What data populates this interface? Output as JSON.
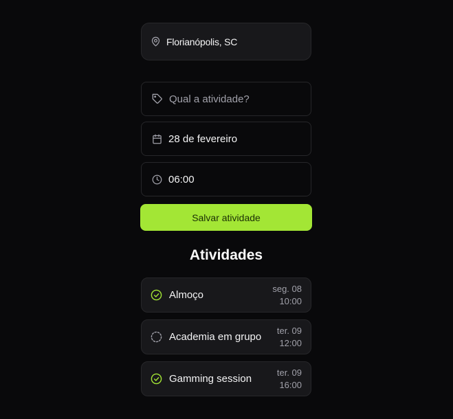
{
  "location": {
    "text": "Florianópolis, SC",
    "icon": "map-pin-icon"
  },
  "form": {
    "activity_placeholder": "Qual a atividade?",
    "activity_icon": "tag-icon",
    "date_value": "28 de fevereiro",
    "date_icon": "calendar-icon",
    "time_value": "06:00",
    "time_icon": "clock-icon",
    "save_label": "Salvar atividade"
  },
  "activities": {
    "title": "Atividades",
    "items": [
      {
        "name": "Almoço",
        "day": "seg. 08",
        "time": "10:00",
        "done": true
      },
      {
        "name": "Academia em grupo",
        "day": "ter. 09",
        "time": "12:00",
        "done": false
      },
      {
        "name": "Gamming session",
        "day": "ter. 09",
        "time": "16:00",
        "done": true
      }
    ]
  },
  "colors": {
    "background": "#09090b",
    "card": "#18181b",
    "border": "#27272a",
    "accent": "#a3e635",
    "muted": "#a1a1aa"
  }
}
